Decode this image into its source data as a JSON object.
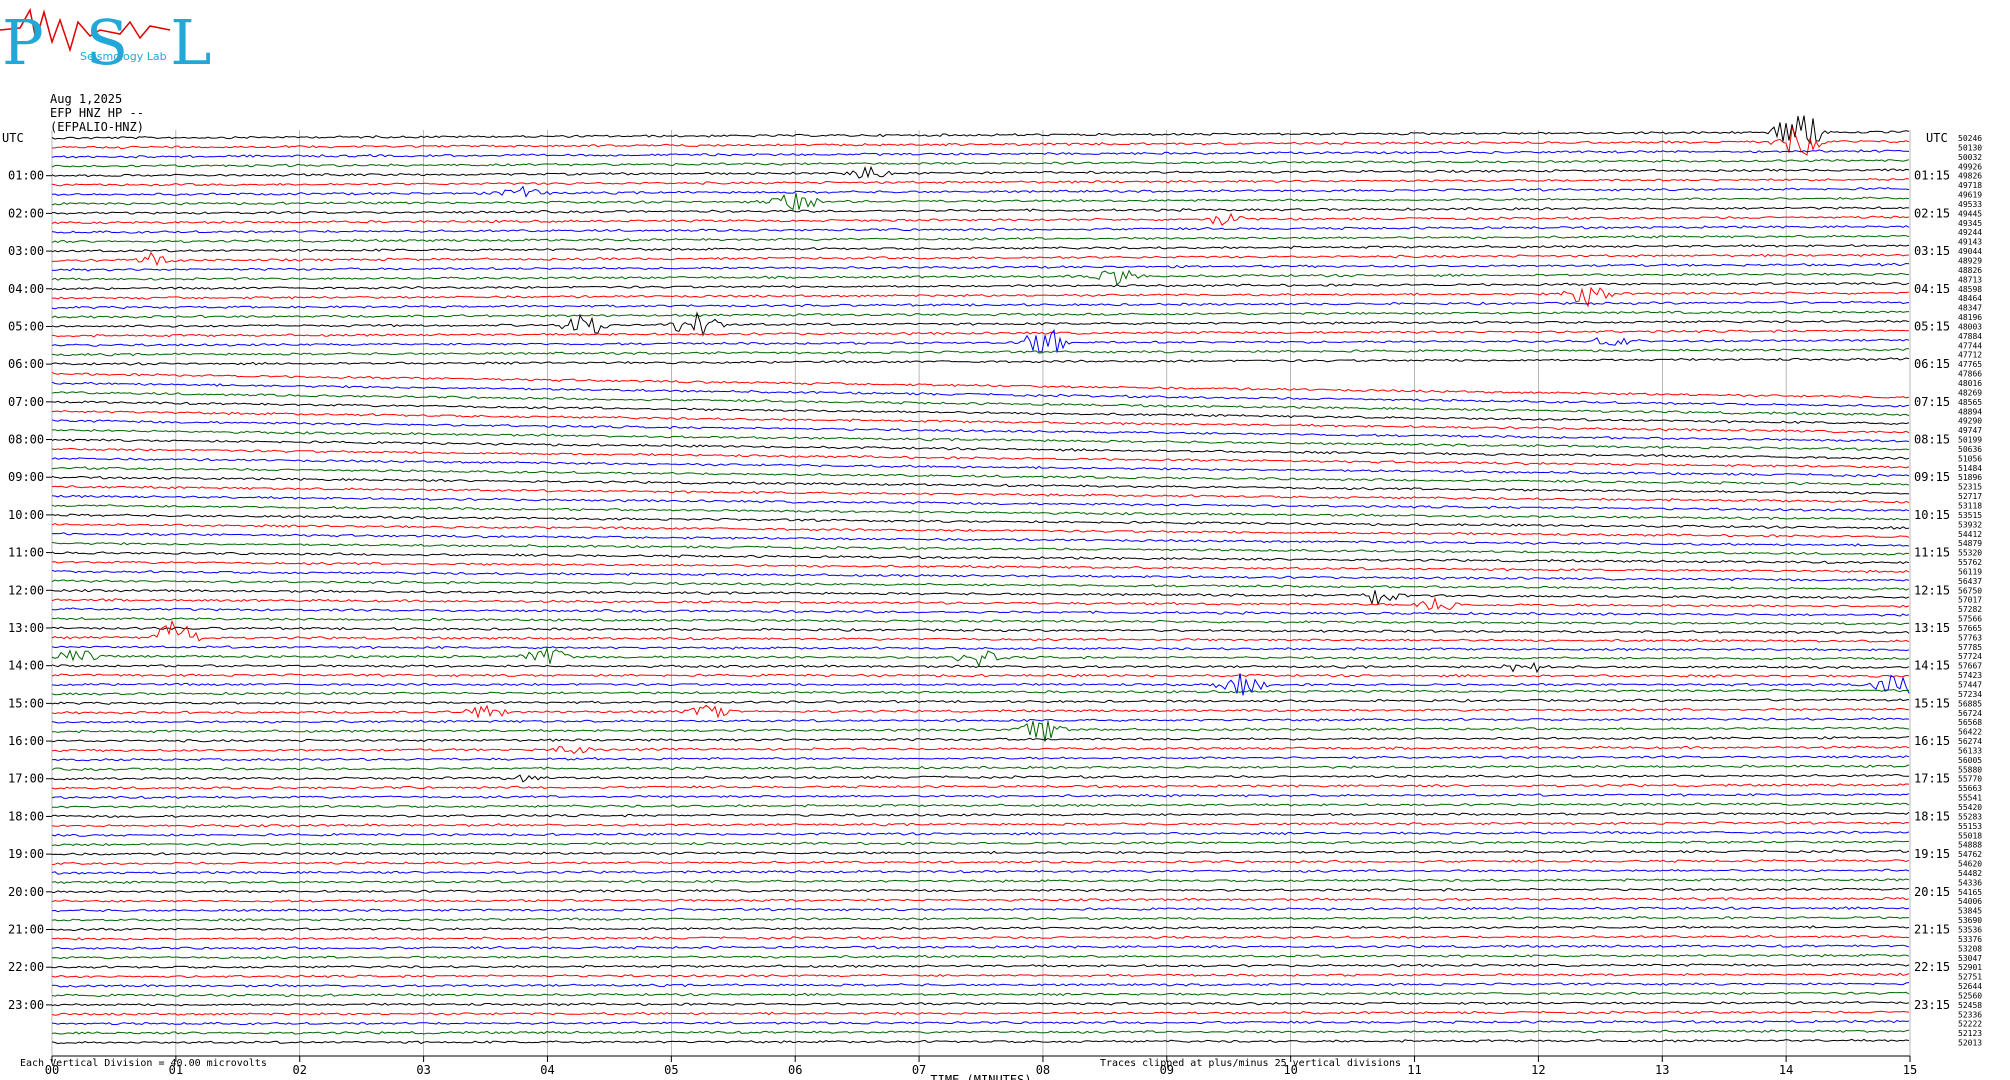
{
  "logo": {
    "letters": "PSL",
    "subtitle": "Seismology Lab"
  },
  "header": {
    "date": "Aug 1,2025",
    "station": "EFP HNZ HP --",
    "channel": "(EFPALIO-HNZ)"
  },
  "left_utc_label": "UTC",
  "right_utc_label": "UTC",
  "footer": {
    "scale_note": "Each Vertical Division =    40.00 microvolts",
    "clip_note": "Traces clipped at plus/minus 25 vertical divisions"
  },
  "chart_data": {
    "type": "line",
    "title": "",
    "xlabel": "TIME (MINUTES)",
    "x_ticks": [
      "00",
      "01",
      "02",
      "03",
      "04",
      "05",
      "06",
      "07",
      "08",
      "09",
      "10",
      "11",
      "12",
      "13",
      "14",
      "15"
    ],
    "xlim": [
      0,
      15
    ],
    "left_hour_labels": [
      "01:00",
      "02:00",
      "03:00",
      "04:00",
      "05:00",
      "06:00",
      "07:00",
      "08:00",
      "09:00",
      "10:00",
      "11:00",
      "12:00",
      "13:00",
      "14:00",
      "15:00",
      "16:00",
      "17:00",
      "18:00",
      "19:00",
      "20:00",
      "21:00",
      "22:00",
      "23:00"
    ],
    "right_hour_labels": [
      "01:15",
      "02:15",
      "03:15",
      "04:15",
      "05:15",
      "06:15",
      "07:15",
      "08:15",
      "09:15",
      "10:15",
      "11:15",
      "12:15",
      "13:15",
      "14:15",
      "15:15",
      "16:15",
      "17:15",
      "18:15",
      "19:15",
      "20:15",
      "21:15",
      "22:15",
      "23:15"
    ],
    "trace_counts": [
      "50246",
      "50130",
      "50032",
      "49926",
      "49826",
      "49718",
      "49619",
      "49533",
      "49445",
      "49345",
      "49244",
      "49143",
      "49044",
      "48929",
      "48826",
      "48713",
      "48598",
      "48464",
      "48347",
      "48196",
      "48003",
      "47884",
      "47744",
      "47712",
      "47765",
      "47866",
      "48016",
      "48269",
      "48565",
      "48894",
      "49290",
      "49747",
      "50199",
      "50636",
      "51056",
      "51484",
      "51896",
      "52315",
      "52717",
      "53118",
      "53515",
      "53932",
      "54412",
      "54879",
      "55320",
      "55762",
      "56119",
      "56437",
      "56750",
      "57017",
      "57282",
      "57566",
      "57665",
      "57763",
      "57785",
      "57724",
      "57667",
      "57423",
      "57447",
      "57234",
      "56885",
      "56724",
      "56568",
      "56422",
      "56274",
      "56133",
      "56005",
      "55880",
      "55770",
      "55663",
      "55541",
      "55420",
      "55283",
      "55153",
      "55018",
      "54888",
      "54762",
      "54620",
      "54482",
      "54336",
      "54165",
      "54006",
      "53845",
      "53690",
      "53536",
      "53376",
      "53208",
      "53047",
      "52901",
      "52751",
      "52644",
      "52560",
      "52458",
      "52336",
      "52222",
      "52123",
      "52013"
    ],
    "trace_colors": [
      "#000000",
      "#ff0000",
      "#0000ff",
      "#006600"
    ],
    "trace_interval_minutes": 15,
    "events": [
      {
        "trace": 0,
        "minute": 14.1,
        "amp": 3.0
      },
      {
        "trace": 1,
        "minute": 14.1,
        "amp": 2.0
      },
      {
        "trace": 4,
        "minute": 6.6,
        "amp": 0.9
      },
      {
        "trace": 6,
        "minute": 3.8,
        "amp": 0.8
      },
      {
        "trace": 7,
        "minute": 6.0,
        "amp": 1.4
      },
      {
        "trace": 9,
        "minute": 9.5,
        "amp": 0.9
      },
      {
        "trace": 13,
        "minute": 0.8,
        "amp": 0.9
      },
      {
        "trace": 15,
        "minute": 8.6,
        "amp": 1.0
      },
      {
        "trace": 17,
        "minute": 12.4,
        "amp": 1.5
      },
      {
        "trace": 20,
        "minute": 4.3,
        "amp": 1.6
      },
      {
        "trace": 20,
        "minute": 5.2,
        "amp": 2.0
      },
      {
        "trace": 22,
        "minute": 8.0,
        "amp": 2.2
      },
      {
        "trace": 22,
        "minute": 12.6,
        "amp": 0.6
      },
      {
        "trace": 48,
        "minute": 10.7,
        "amp": 1.2
      },
      {
        "trace": 49,
        "minute": 11.2,
        "amp": 0.9
      },
      {
        "trace": 53,
        "minute": 1.0,
        "amp": 2.4
      },
      {
        "trace": 55,
        "minute": 0.2,
        "amp": 1.1
      },
      {
        "trace": 55,
        "minute": 4.0,
        "amp": 1.2
      },
      {
        "trace": 55,
        "minute": 7.5,
        "amp": 1.2
      },
      {
        "trace": 56,
        "minute": 11.9,
        "amp": 0.9
      },
      {
        "trace": 58,
        "minute": 9.6,
        "amp": 1.4
      },
      {
        "trace": 58,
        "minute": 14.9,
        "amp": 1.8
      },
      {
        "trace": 61,
        "minute": 3.5,
        "amp": 1.1
      },
      {
        "trace": 61,
        "minute": 5.3,
        "amp": 0.8
      },
      {
        "trace": 63,
        "minute": 8.0,
        "amp": 1.4
      },
      {
        "trace": 65,
        "minute": 4.2,
        "amp": 0.6
      },
      {
        "trace": 68,
        "minute": 3.8,
        "amp": 0.5
      }
    ]
  }
}
